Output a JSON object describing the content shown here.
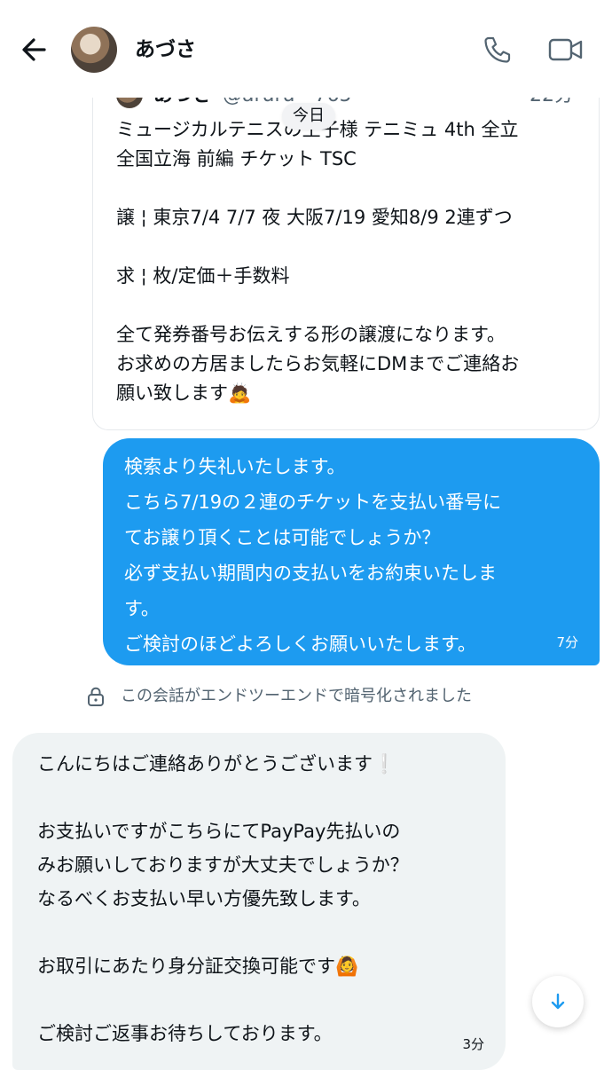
{
  "header": {
    "contact_name": "あづさ",
    "icons": {
      "back": "arrow-left-icon",
      "call": "phone-icon",
      "video": "video-icon"
    }
  },
  "quoted_tweet": {
    "author_name": "あづさ",
    "author_handle": "@aruru__765",
    "time": "22分",
    "body": "ミュージカルテニスの王子様 テニミュ 4th 全立\n全国立海 前編 チケット TSC\n\n譲 ¦ 東京7/4 7/7 夜 大阪7/19 愛知8/9 2連ずつ\n\n求 ¦ 枚/定価＋手数料\n\n全て発券番号お伝えする形の譲渡になります。\nお求めの方居ましたらお気軽にDMまでご連絡お\n願い致します🙇"
  },
  "date_divider": "今日",
  "messages": [
    {
      "direction": "sent",
      "text": "検索より失礼いたします。\nこちら7/19の２連のチケットを支払い番号に\nてお譲り頂くことは可能でしょうか？\n必ず支払い期間内の支払いをお約束いたしま\nす。\nご検討のほどよろしくお願いいたします。",
      "time": "7分"
    },
    {
      "direction": "received",
      "text": "こんにちはご連絡ありがとうございます❕\n\nお支払いですがこちらにてPayPay先払いの\nみお願いしておりますが大丈夫でしょうか？\nなるべくお支払い早い方優先致します。\n\nお取引にあたり身分証交換可能です🙆\n\nご検討ご返事お待ちしております。",
      "time": "3分"
    }
  ],
  "encryption_notice": "この会話がエンドツーエンドで暗号化されました",
  "colors": {
    "accent": "#1d9bf0",
    "received_bubble": "#eff3f4",
    "secondary_text": "#536471"
  }
}
